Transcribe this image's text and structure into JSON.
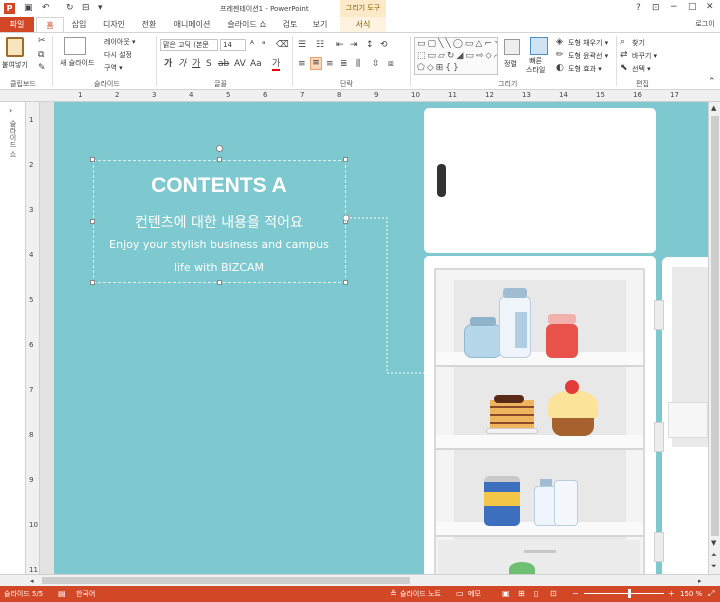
{
  "window": {
    "title": "프레젠테이션1 - PowerPoint",
    "contextual_group": "그리기 도구",
    "account": "로그이"
  },
  "tabs": {
    "file": "파일",
    "items": [
      "홈",
      "삽입",
      "디자인",
      "전환",
      "애니메이션",
      "슬라이드 쇼",
      "검토",
      "보기"
    ],
    "contextual": "서식"
  },
  "ribbon": {
    "clipboard": {
      "paste": "붙여넣기",
      "label": "클립보드"
    },
    "slides": {
      "new_slide": "새 슬라이드",
      "layout": "레이아웃 ▾",
      "reset": "다시 설정",
      "section": "구역 ▾",
      "label": "슬라이드"
    },
    "font": {
      "name": "맑은 고딕 (본문",
      "size": "14",
      "label": "글꼴"
    },
    "paragraph": {
      "label": "단락"
    },
    "drawing": {
      "arrange": "정렬",
      "quick_styles": "빠른\n스타일",
      "fill": "도형 채우기 ▾",
      "outline": "도형 윤곽선 ▾",
      "effects": "도형 효과 ▾",
      "label": "그리기"
    },
    "editing": {
      "find": "찾기",
      "replace": "바꾸기 ▾",
      "select": "선택 ▾",
      "label": "편집"
    }
  },
  "left_panel": {
    "label": "슬라이드 쇼"
  },
  "slide": {
    "title": "CONTENTS A",
    "korean": "컨텐츠에 대한 내용을 적어요",
    "desc1": "Enjoy your stylish business and campus",
    "desc2": "life with BIZCAM"
  },
  "ruler_numbers": [
    "1",
    "2",
    "3",
    "4",
    "5",
    "6",
    "7",
    "8",
    "9",
    "10",
    "11",
    "12",
    "13",
    "14",
    "15",
    "16",
    "17"
  ],
  "vruler_numbers": [
    "1",
    "2",
    "3",
    "4",
    "5",
    "6",
    "7",
    "8",
    "9",
    "10",
    "11"
  ],
  "status": {
    "slide": "슬라이드 5/5",
    "language": "한국어",
    "notes": "슬라이드 노트",
    "comments": "메모",
    "zoom": "150 %"
  },
  "colors": {
    "accent": "#d24726",
    "slide_bg": "#7ec8d0",
    "fridge": "#ffffff"
  }
}
